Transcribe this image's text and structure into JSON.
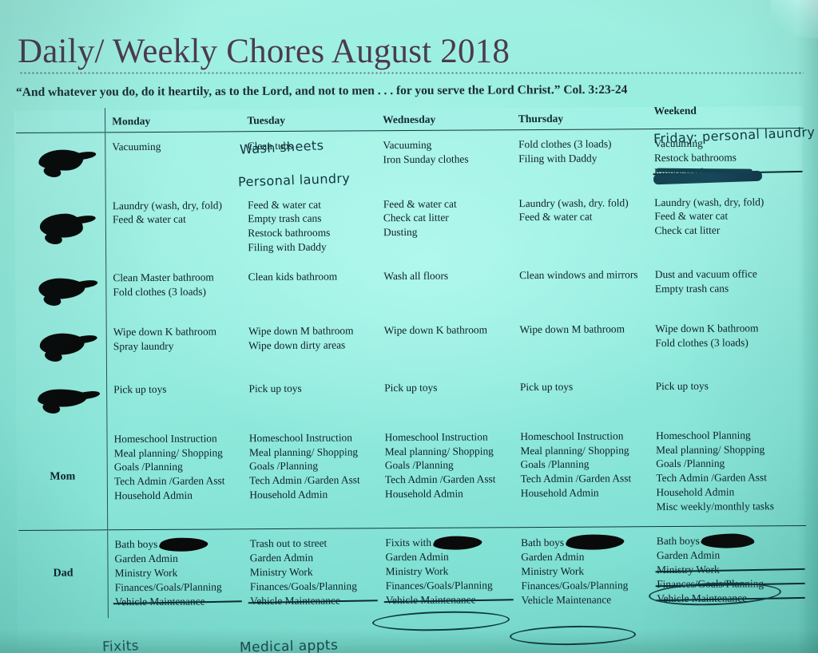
{
  "page": {
    "title": "Daily/ Weekly Chores August 2018",
    "subtitle": "“And whatever you do, do it heartily, as to the Lord, and not to men . . . for you serve the Lord Christ.” Col. 3:23-24",
    "background_color": "#8fe9da",
    "title_color": "#4a3b52",
    "ink_color": "#101f27",
    "pen_color": "#12343f"
  },
  "table": {
    "columns": [
      {
        "key": "icon",
        "label": ""
      },
      {
        "key": "monday",
        "label": "Monday"
      },
      {
        "key": "tuesday",
        "label": "Tuesday"
      },
      {
        "key": "wednesday",
        "label": "Wednesday"
      },
      {
        "key": "thursday",
        "label": "Thursday"
      },
      {
        "key": "weekend",
        "label": "Weekend"
      }
    ],
    "rows": [
      {
        "label": "",
        "label_redacted": true,
        "monday": [
          "Vacuuming"
        ],
        "tuesday": [
          "Clean tubs"
        ],
        "wednesday": [
          "Vacuuming",
          "Iron Sunday clothes"
        ],
        "thursday": [
          "Fold clothes (3 loads)",
          "Filing with Daddy"
        ],
        "weekend": [
          "Vacuuming",
          "Restock bathrooms",
          "Empty trash cans"
        ],
        "weekend_struck": [
          "Empty trash cans"
        ]
      },
      {
        "label": "",
        "label_redacted": true,
        "monday": [
          "Laundry (wash, dry, fold)",
          "Feed & water cat"
        ],
        "tuesday": [
          "Feed & water cat",
          "Empty trash cans",
          "Restock bathrooms",
          "Filing with Daddy"
        ],
        "wednesday": [
          "Feed & water cat",
          "Check cat litter",
          "Dusting"
        ],
        "thursday": [
          "Laundry (wash, dry. fold)",
          "Feed & water cat"
        ],
        "weekend": [
          "Laundry (wash, dry, fold)",
          "Feed & water cat",
          "Check cat litter"
        ]
      },
      {
        "label": "",
        "label_redacted": true,
        "monday": [
          "Clean Master bathroom",
          "Fold clothes (3 loads)"
        ],
        "tuesday": [
          "Clean kids bathroom"
        ],
        "wednesday": [
          "Wash all floors"
        ],
        "thursday": [
          "Clean windows and mirrors"
        ],
        "weekend": [
          "Dust and vacuum office",
          "Empty trash cans"
        ]
      },
      {
        "label": "",
        "label_redacted": true,
        "monday": [
          "Wipe down K bathroom",
          "Spray laundry"
        ],
        "tuesday": [
          "Wipe down M bathroom",
          "Wipe down dirty areas"
        ],
        "wednesday": [
          "Wipe down K bathroom"
        ],
        "thursday": [
          "Wipe down M bathroom"
        ],
        "weekend": [
          "Wipe down K bathroom",
          "Fold clothes (3 loads)"
        ]
      },
      {
        "label": "",
        "label_redacted": true,
        "monday": [
          "Pick up toys"
        ],
        "tuesday": [
          "Pick up toys"
        ],
        "wednesday": [
          "Pick up toys"
        ],
        "thursday": [
          "Pick up toys"
        ],
        "weekend": [
          "Pick up toys"
        ]
      },
      {
        "label": "Mom",
        "label_redacted": false,
        "monday": [
          "Homeschool Instruction",
          "Meal planning/ Shopping",
          "Goals /Planning",
          "Tech Admin /Garden Asst",
          "Household Admin"
        ],
        "tuesday": [
          "Homeschool Instruction",
          "Meal planning/ Shopping",
          "Goals /Planning",
          "Tech Admin /Garden Asst",
          "Household Admin"
        ],
        "wednesday": [
          "Homeschool Instruction",
          "Meal planning/ Shopping",
          "Goals /Planning",
          "Tech Admin /Garden Asst",
          "Household Admin"
        ],
        "thursday": [
          "Homeschool Instruction",
          "Meal planning/ Shopping",
          "Goals /Planning",
          "Tech Admin /Garden Asst",
          "Household Admin"
        ],
        "weekend": [
          "Homeschool Planning",
          "Meal planning/ Shopping",
          "Goals /Planning",
          "Tech Admin /Garden Asst",
          "Household Admin",
          "Misc weekly/monthly tasks"
        ]
      },
      {
        "label": "Dad",
        "label_redacted": false,
        "monday": [
          "Bath boys",
          "Garden Admin",
          "Ministry Work",
          "Finances/Goals/Planning",
          "Vehicle Maintenance"
        ],
        "monday_struck": [
          "Vehicle Maintenance"
        ],
        "monday_redacted": [
          "Bath boys"
        ],
        "tuesday": [
          "Trash out to street",
          "Garden Admin",
          "Ministry Work",
          "Finances/Goals/Planning",
          "Vehicle Maintenance"
        ],
        "tuesday_struck": [
          "Vehicle Maintenance"
        ],
        "wednesday": [
          "Fixits with",
          "Garden Admin",
          "Ministry Work",
          "Finances/Goals/Planning",
          "Vehicle Maintenance"
        ],
        "wednesday_struck": [
          "Vehicle Maintenance"
        ],
        "wednesday_redacted": [
          "Fixits with"
        ],
        "thursday": [
          "Bath boys",
          "Garden Admin",
          "Ministry Work",
          "Finances/Goals/Planning",
          "Vehicle Maintenance"
        ],
        "thursday_redacted": [
          "Bath boys"
        ],
        "weekend": [
          "Bath boys",
          "Garden Admin",
          "Ministry Work",
          "Finances/Goals/Planning",
          "Vehicle Maintenance"
        ],
        "weekend_struck": [
          "Ministry Work",
          "Finances/Goals/Planning",
          "Vehicle Maintenance"
        ],
        "weekend_redacted": [
          "Bath boys"
        ]
      }
    ]
  },
  "handwriting": [
    {
      "id": "wash_sheets",
      "text": "Wash sheets",
      "column": "tuesday",
      "row": 0
    },
    {
      "id": "personal_laundry",
      "text": "Personal  laundry",
      "column": "tuesday",
      "row": 0
    },
    {
      "id": "friday_note",
      "text": "Friday: personal  laundry",
      "column": "weekend",
      "row": 0
    },
    {
      "id": "scratch_out",
      "text": "",
      "column": "weekend",
      "row": 0
    },
    {
      "id": "bottom_fixits",
      "text": "Fixits",
      "column": "monday",
      "row": 6
    },
    {
      "id": "bottom_medical",
      "text": "Medical appts",
      "column": "tuesday",
      "row": 6
    }
  ],
  "pen_circles": [
    {
      "id": "circle_wed_finances",
      "target": "Finances/Goals/Planning",
      "column": "wednesday",
      "row": 6
    },
    {
      "id": "circle_thu_vehicle",
      "target": "Vehicle Maintenance",
      "column": "thursday",
      "row": 6
    },
    {
      "id": "circle_wk_garden",
      "target": "Garden Admin",
      "column": "weekend",
      "row": 6
    }
  ]
}
